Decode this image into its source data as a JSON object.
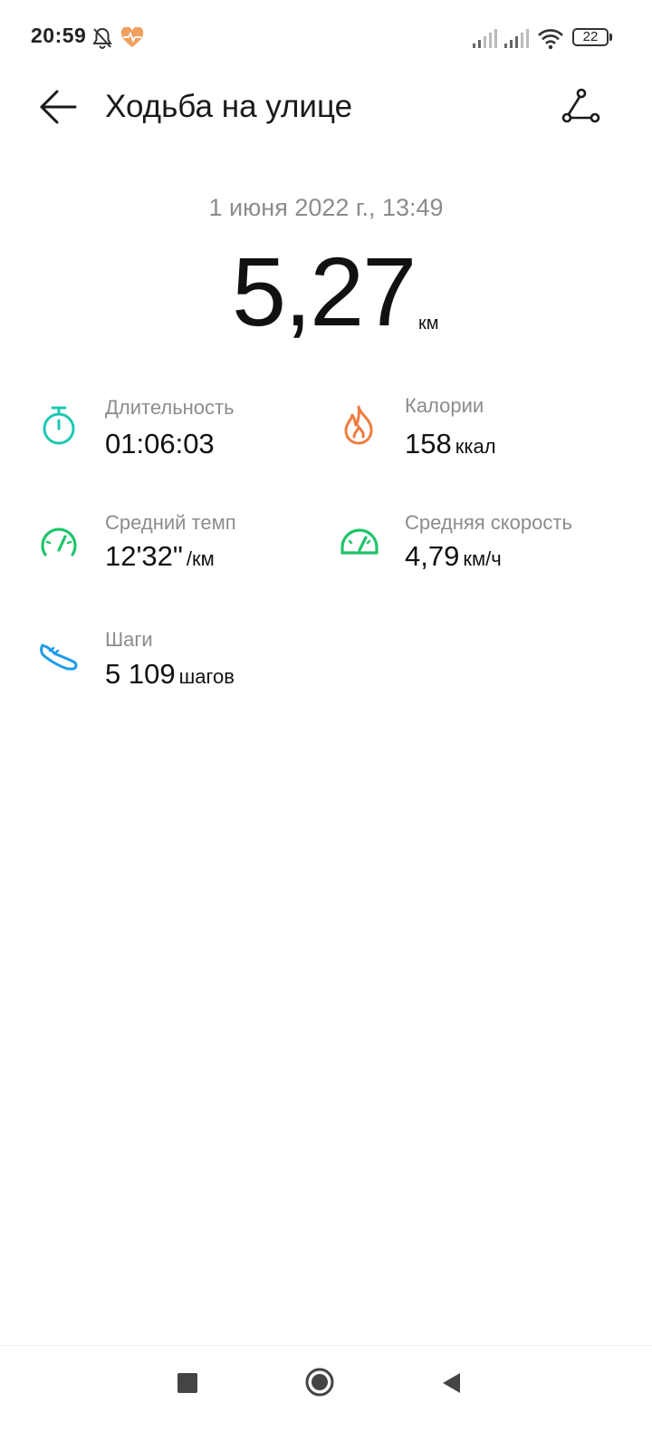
{
  "status_bar": {
    "time": "20:59",
    "icons": [
      "bell-off-icon",
      "heart-rate-icon",
      "signal-icon",
      "signal-icon",
      "wifi-icon",
      "battery-icon"
    ],
    "battery_level": "22"
  },
  "header": {
    "title": "Ходьба на улице",
    "back_icon": "arrow-left-icon",
    "route_icon": "route-icon"
  },
  "summary": {
    "date": "1 июня 2022 г., 13:49",
    "distance": "5,27",
    "distance_unit": "км"
  },
  "metrics": {
    "duration": {
      "label": "Длительность",
      "value": "01:06:03",
      "unit": "",
      "icon": "stopwatch-icon",
      "color": "#1cc9b4"
    },
    "calories": {
      "label": "Калории",
      "value": "158",
      "unit": "ккал",
      "icon": "flame-icon",
      "color": "#f07c3e"
    },
    "pace": {
      "label": "Средний темп",
      "value": "12'32\"",
      "unit": "/км",
      "icon": "speedometer-icon",
      "color": "#1fc46a"
    },
    "speed": {
      "label": "Средняя скорость",
      "value": "4,79",
      "unit": "км/ч",
      "icon": "speed-gauge-icon",
      "color": "#1fc46a"
    },
    "steps": {
      "label": "Шаги",
      "value": "5 109",
      "unit": "шагов",
      "icon": "sneaker-icon",
      "color": "#1e9be8"
    }
  },
  "nav_bar": {
    "recents_icon": "square-icon",
    "home_icon": "circle-icon",
    "back_icon": "triangle-back-icon"
  }
}
